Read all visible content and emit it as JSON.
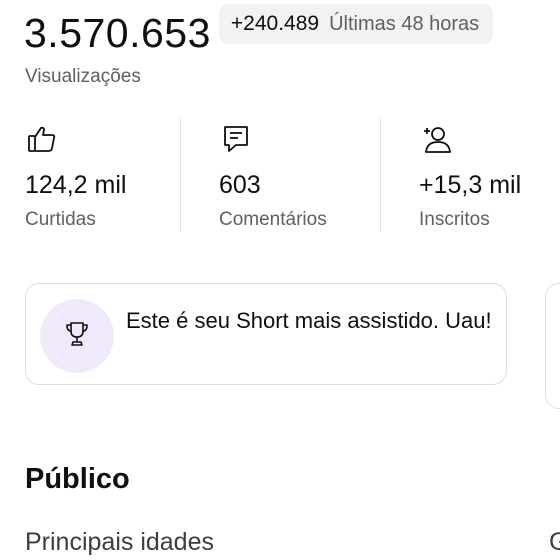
{
  "views": {
    "count": "3.570.653",
    "delta": "+240.489",
    "period": "Últimas 48 horas",
    "label": "Visualizações"
  },
  "stats": [
    {
      "icon": "thumbs-up-icon",
      "value": "124,2 mil",
      "label": "Curtidas"
    },
    {
      "icon": "comment-icon",
      "value": "603",
      "label": "Comentários"
    },
    {
      "icon": "add-subscriber-icon",
      "value": "+15,3 mil",
      "label": "Inscritos"
    }
  ],
  "highlight_card": {
    "icon": "trophy-icon",
    "text": "Este é seu Short mais assistido. Uau!"
  },
  "audience": {
    "title": "Público",
    "top_ages_label": "Principais idades",
    "next_heading_peek": "G"
  },
  "colors": {
    "text_primary": "#0f0f0f",
    "text_secondary": "#606060",
    "pill_bg": "#f2f2f2",
    "badge_bg": "#efe9fb",
    "border": "#dddddd"
  }
}
